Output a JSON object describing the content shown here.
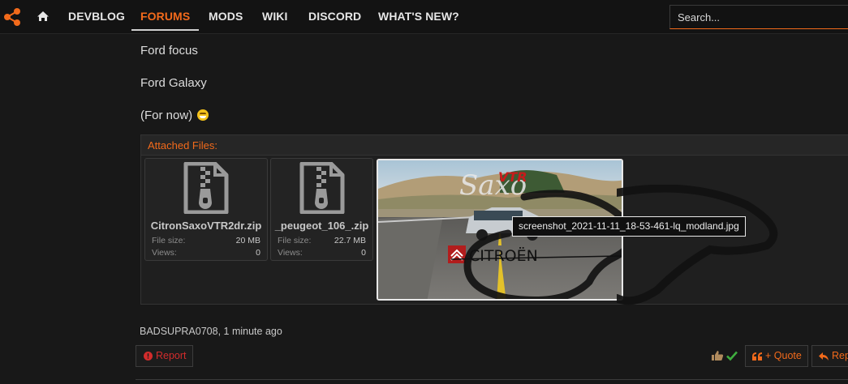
{
  "nav": {
    "items": [
      {
        "label": "DEVBLOG"
      },
      {
        "label": "FORUMS"
      },
      {
        "label": "MODS"
      },
      {
        "label": "WIKI"
      },
      {
        "label": "DISCORD"
      },
      {
        "label": "WHAT'S NEW?"
      }
    ],
    "active": "FORUMS",
    "search_placeholder": "Search..."
  },
  "post": {
    "lines": [
      "Ford focus",
      "Ford Galaxy",
      "(For now)"
    ]
  },
  "attachments": {
    "title": "Attached Files:",
    "files": [
      {
        "name": "CitronSaxoVTR2dr.zip",
        "size_label": "File size:",
        "size": "20 MB",
        "views_label": "Views:",
        "views": "0"
      },
      {
        "name": "_peugeot_106_.zip",
        "size_label": "File size:",
        "size": "22.7 MB",
        "views_label": "Views:",
        "views": "0"
      }
    ],
    "image": {
      "tooltip": "screenshot_2021-11-11_18-53-461-lq_modland.jpg",
      "banner_text": "CITROËN",
      "logo_text": "Saxo",
      "vts_text": "VTR"
    }
  },
  "footer": {
    "author": "BADSUPRA0708",
    "time": ", 1 minute ago",
    "report_label": "Report",
    "quote_label": "+ Quote",
    "reply_label": "Rep"
  },
  "colors": {
    "accent": "#f26a1b",
    "danger": "#d22c2c",
    "background": "#181818"
  }
}
